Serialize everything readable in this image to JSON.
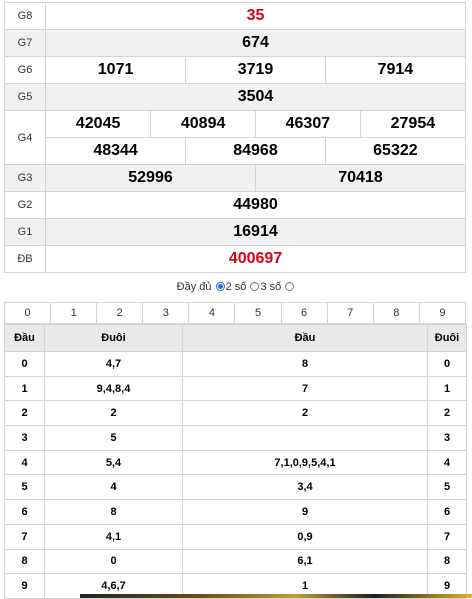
{
  "prizes": {
    "g8": {
      "label": "G8",
      "value": "35"
    },
    "g7": {
      "label": "G7",
      "value": "674"
    },
    "g6": {
      "label": "G6",
      "values": [
        "1071",
        "3719",
        "7914"
      ]
    },
    "g5": {
      "label": "G5",
      "value": "3504"
    },
    "g4": {
      "label": "G4",
      "row1": [
        "42045",
        "40894",
        "46307",
        "27954"
      ],
      "row2": [
        "48344",
        "84968",
        "65322"
      ]
    },
    "g3": {
      "label": "G3",
      "values": [
        "52996",
        "70418"
      ]
    },
    "g2": {
      "label": "G2",
      "value": "44980"
    },
    "g1": {
      "label": "G1",
      "value": "16914"
    },
    "db": {
      "label": "ĐB",
      "value": "400697"
    }
  },
  "options": {
    "full": "Đầy đủ",
    "two": "2 số",
    "three": "3 số",
    "selected": "two"
  },
  "digits": [
    "0",
    "1",
    "2",
    "3",
    "4",
    "5",
    "6",
    "7",
    "8",
    "9"
  ],
  "loto": {
    "headers": [
      "Đầu",
      "Đuôi",
      "Đầu",
      "Đuôi"
    ],
    "rows": [
      {
        "d": "0",
        "tail": "4,7",
        "head": "8",
        "d2": "0"
      },
      {
        "d": "1",
        "tail": "9,4,8,4",
        "head": "7",
        "d2": "1"
      },
      {
        "d": "2",
        "tail": "2",
        "head": "2",
        "d2": "2"
      },
      {
        "d": "3",
        "tail": "5",
        "head": "",
        "d2": "3"
      },
      {
        "d": "4",
        "tail": "5,4",
        "head": "7,1,0,9,5,4,1",
        "d2": "4"
      },
      {
        "d": "5",
        "tail": "4",
        "head": "3,4",
        "d2": "5"
      },
      {
        "d": "6",
        "tail": "8",
        "head": "9",
        "d2": "6"
      },
      {
        "d": "7",
        "tail": "4,1",
        "head": "0,9",
        "d2": "7"
      },
      {
        "d": "8",
        "tail": "0",
        "head": "6,1",
        "d2": "8"
      },
      {
        "d": "9",
        "tail": "4,6,7",
        "head": "1",
        "d2": "9"
      }
    ]
  },
  "colors": {
    "special": "#d8001b",
    "radio": "#1a73e8"
  }
}
